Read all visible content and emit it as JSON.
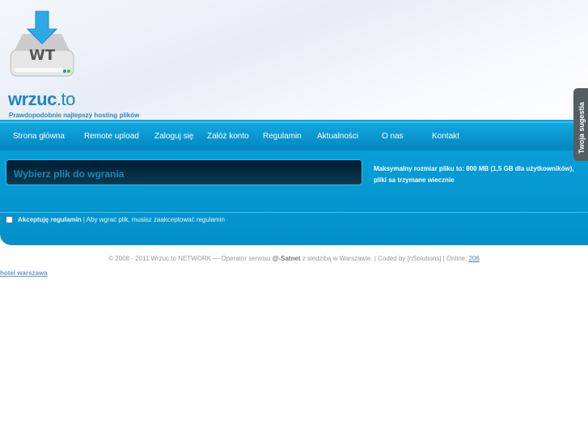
{
  "brand": {
    "name": "wrzuc",
    "tld": ".to",
    "logo_text": "WT",
    "tagline": "Prawdopodobnie najlepszy hosting plików"
  },
  "nav": [
    "Strona główna",
    "Remote upload",
    "Zaloguj się",
    "Załóż konto",
    "Regulamin",
    "Aktualności",
    "O nas",
    "Kontakt"
  ],
  "upload": {
    "label": "Wybierz plik do wgrania"
  },
  "info": "Maksymalny rozmiar pliku to: 800 MB (1,5 GB dla użytkowników), pliki sa trzymane wiecznie",
  "accept": {
    "bold": "Akceptuję regulamin",
    "rest": " | Aby wgrać plik, musisz zaakceptować regulamin"
  },
  "footer": {
    "pre": "© 2008 - 2011 Wrzuc.to NETWORK — Operator serwisu ",
    "operator": "@-Satnet",
    "post": " z siedzibą w Warszawie. | Coded by [nSolutions] | Online: ",
    "online": "206"
  },
  "hotel_link": "hotel warszawa",
  "suggestion": "Twoja sugestia"
}
